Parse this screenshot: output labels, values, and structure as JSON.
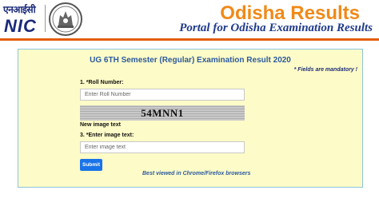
{
  "header": {
    "logo_hindi": "एनआईसी",
    "logo_latin": "NIC",
    "title": "Odisha Results",
    "subtitle": "Portal for Odisha Examination Results"
  },
  "form": {
    "title": "UG 6TH Semester (Regular) Examination Result 2020",
    "mandatory_note": "* Fields are mandatory !",
    "roll_label": "1. *Roll Number:",
    "roll_placeholder": "Enter Roll Number",
    "roll_value": "",
    "captcha_text": "54MNN1",
    "new_image_label": "New image text",
    "image_text_label": "3. *Enter image text:",
    "image_text_placeholder": "Enter image text",
    "image_text_value": "",
    "submit_label": "Submit",
    "browser_note": "Best viewed in Chrome/Firefox browsers"
  },
  "colors": {
    "title_orange": "#f08a18",
    "subtitle_blue": "#1f3a8a",
    "rule_orange": "#e35d0a",
    "panel_bg": "#fdfbc7",
    "submit_blue": "#1a73e8"
  }
}
